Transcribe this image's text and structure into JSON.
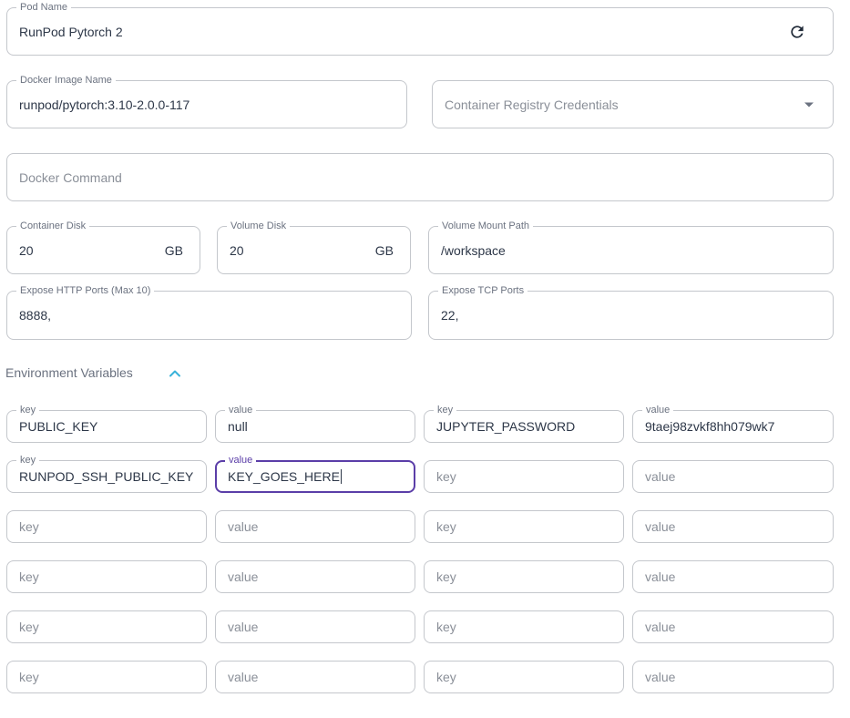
{
  "pod_name": {
    "label": "Pod Name",
    "value": "RunPod Pytorch 2",
    "refresh_icon": "refresh-icon"
  },
  "docker_image": {
    "label": "Docker Image Name",
    "value": "runpod/pytorch:3.10-2.0.0-117"
  },
  "registry_credentials": {
    "placeholder": "Container Registry Credentials",
    "icon": "chevron-down-icon"
  },
  "docker_command": {
    "placeholder": "Docker Command"
  },
  "container_disk": {
    "label": "Container Disk",
    "value": "20",
    "unit": "GB"
  },
  "volume_disk": {
    "label": "Volume Disk",
    "value": "20",
    "unit": "GB"
  },
  "volume_mount_path": {
    "label": "Volume Mount Path",
    "value": "/workspace"
  },
  "http_ports": {
    "label": "Expose HTTP Ports (Max 10)",
    "value": "8888,"
  },
  "tcp_ports": {
    "label": "Expose TCP Ports",
    "value": "22,"
  },
  "env": {
    "title": "Environment Variables",
    "toggle_icon": "chevron-up-icon",
    "key_label": "key",
    "value_label": "value",
    "key_placeholder": "key",
    "value_placeholder": "value",
    "rows": [
      [
        {
          "key": "PUBLIC_KEY",
          "value": "null"
        },
        {
          "key": "JUPYTER_PASSWORD",
          "value": "9taej98zvkf8hh079wk7"
        }
      ],
      [
        {
          "key": "RUNPOD_SSH_PUBLIC_KEY",
          "value": "KEY_GOES_HERE"
        },
        {
          "key": "",
          "value": ""
        }
      ],
      [
        {
          "key": "",
          "value": ""
        },
        {
          "key": "",
          "value": ""
        }
      ],
      [
        {
          "key": "",
          "value": ""
        },
        {
          "key": "",
          "value": ""
        }
      ],
      [
        {
          "key": "",
          "value": ""
        },
        {
          "key": "",
          "value": ""
        }
      ],
      [
        {
          "key": "",
          "value": ""
        },
        {
          "key": "",
          "value": ""
        }
      ]
    ]
  },
  "colors": {
    "border": "#c4c7cc",
    "focus": "#5b3ea8",
    "accent": "#38b2d9",
    "text": "#2d3748",
    "muted": "#6b7280"
  }
}
